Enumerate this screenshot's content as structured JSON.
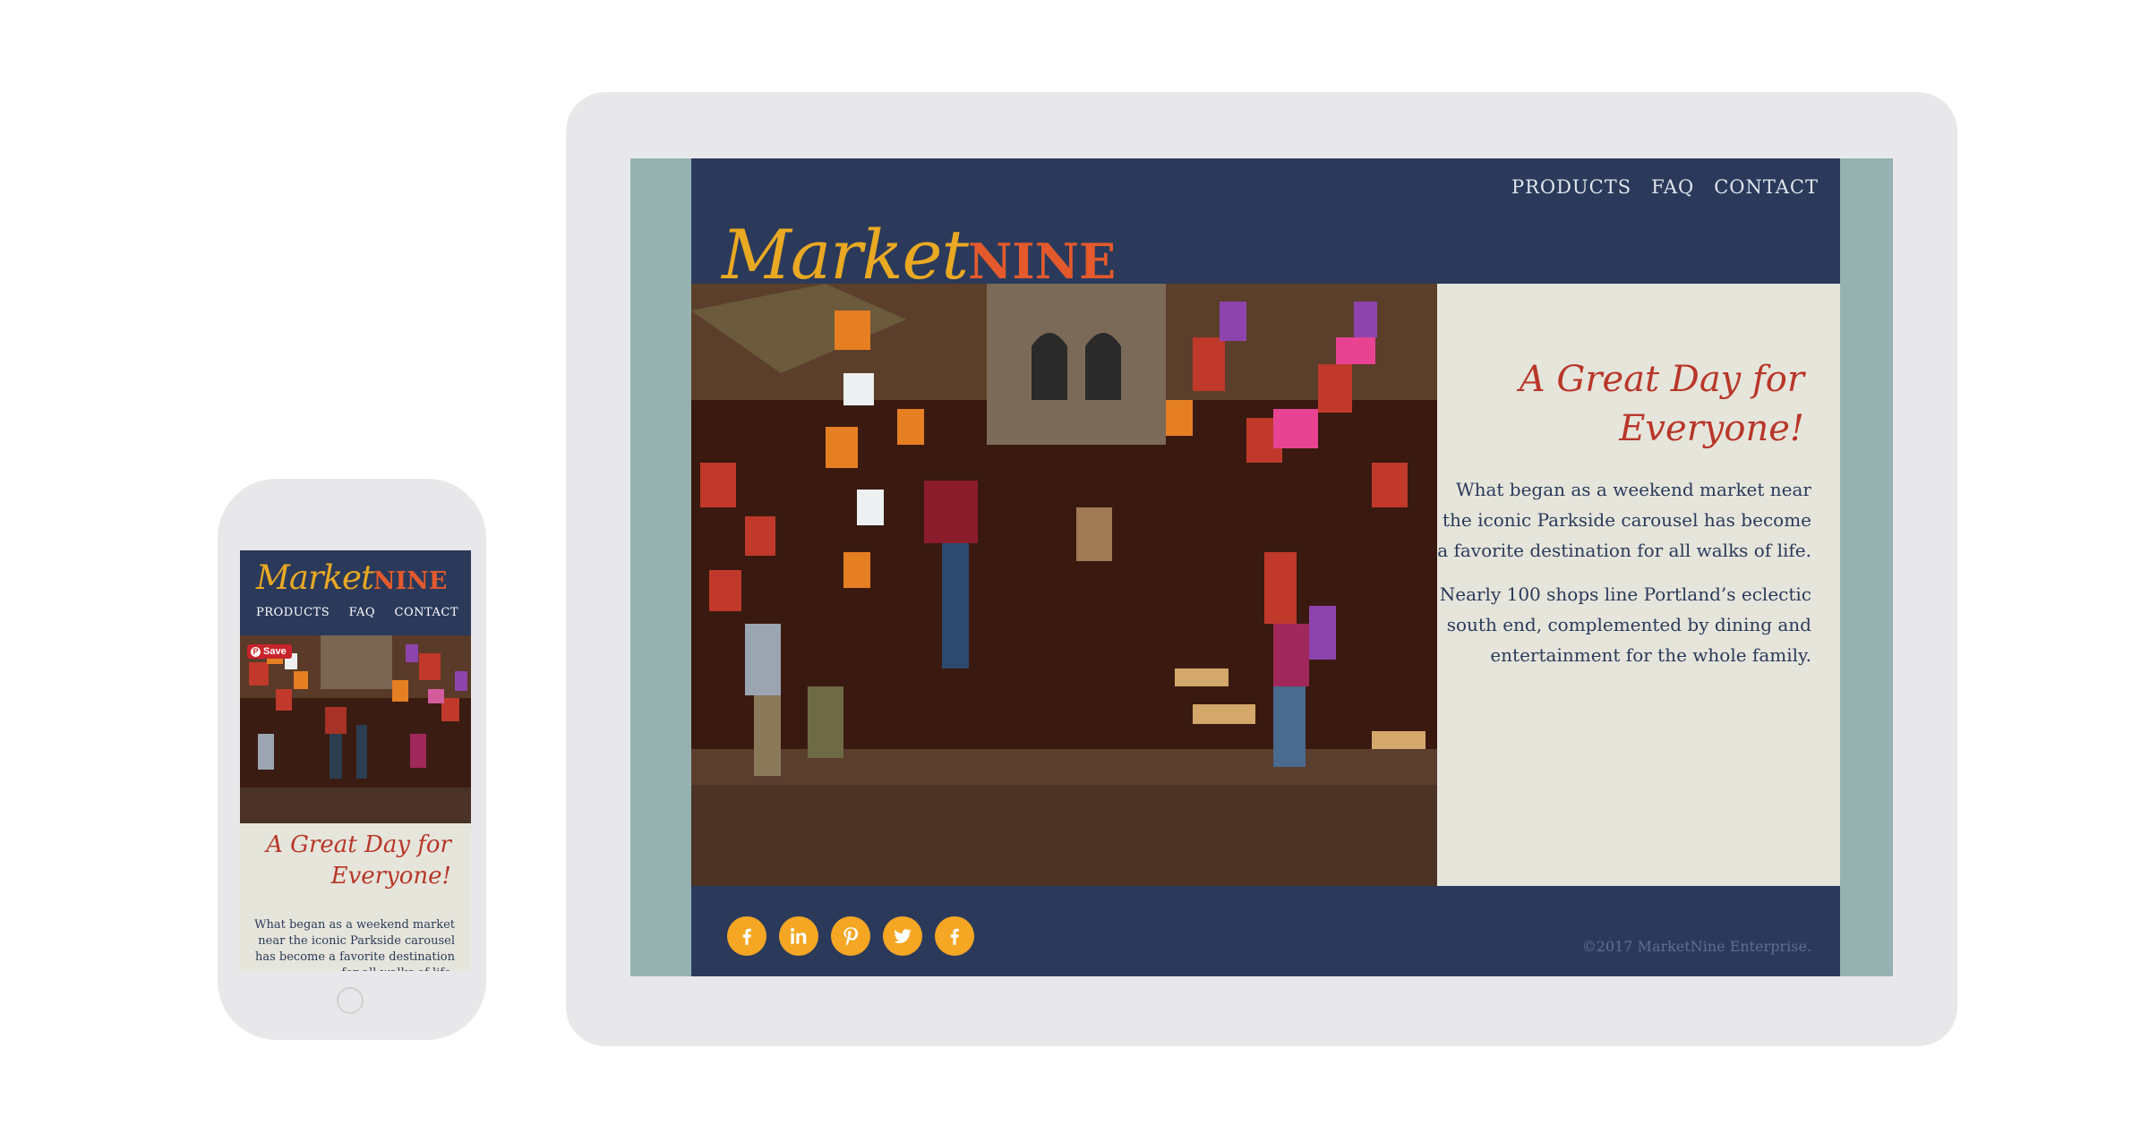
{
  "brand": {
    "market": "Market",
    "nine": "NINE"
  },
  "nav": {
    "products": "PRODUCTS",
    "faq": "FAQ",
    "contact": "CONTACT"
  },
  "mobile": {
    "save_label": "Save",
    "heading_line1": "A Great Day for",
    "heading_line2": "Everyone!",
    "intro": "What began as a weekend market near the iconic Parkside carousel has become a favorite destination for all walks of life."
  },
  "tablet": {
    "heading_line1": "A Great Day for",
    "heading_line2": "Everyone!",
    "paragraph1": "What began as a weekend market near the iconic Parkside carousel has become a favorite destination for all walks of life.",
    "paragraph2": "Nearly 100 shops line Portland’s eclectic south end, complemented by dining and entertainment for the whole family.",
    "copyright": "©2017 MarketNine Enterprise."
  },
  "social_icons": [
    "facebook-icon",
    "linkedin-icon",
    "pinterest-icon",
    "twitter-icon",
    "facebook-icon"
  ],
  "colors": {
    "navy": "#2b3a5b",
    "gold": "#e9a922",
    "orange": "#e45a2c",
    "heading_red": "#b8372a",
    "cream": "#e6e5db",
    "teal_frame": "#95b2b1",
    "social_orange": "#f5a623"
  }
}
